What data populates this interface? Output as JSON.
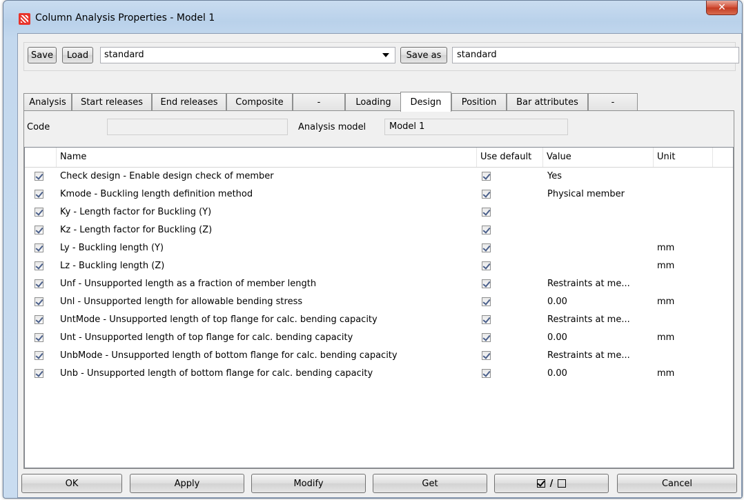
{
  "window": {
    "title": "Column Analysis Properties - Model 1"
  },
  "toolbar": {
    "save_label": "Save",
    "load_label": "Load",
    "preset_value": "standard",
    "save_as_label": "Save as",
    "save_as_value": "standard"
  },
  "tabs": [
    "Analysis",
    "Start releases",
    "End releases",
    "Composite",
    "-",
    "Loading",
    "Design",
    "Position",
    "Bar attributes",
    "-"
  ],
  "active_tab": "Design",
  "design": {
    "code_label": "Code",
    "code_value": "",
    "analysis_model_label": "Analysis model",
    "analysis_model_value": "Model 1"
  },
  "table": {
    "columns": [
      "Name",
      "Use default",
      "Value",
      "Unit"
    ],
    "rows": [
      {
        "checked": true,
        "name": "Check design - Enable design check of member",
        "use_default": true,
        "value": "Yes",
        "unit": ""
      },
      {
        "checked": true,
        "name": "Kmode - Buckling length definition method",
        "use_default": true,
        "value": "Physical member",
        "unit": ""
      },
      {
        "checked": true,
        "name": "Ky - Length factor for Buckling (Y)",
        "use_default": true,
        "value": "",
        "unit": ""
      },
      {
        "checked": true,
        "name": "Kz - Length factor for Buckling (Z)",
        "use_default": true,
        "value": "",
        "unit": ""
      },
      {
        "checked": true,
        "name": "Ly - Buckling length (Y)",
        "use_default": true,
        "value": "",
        "unit": "mm"
      },
      {
        "checked": true,
        "name": "Lz - Buckling length (Z)",
        "use_default": true,
        "value": "",
        "unit": "mm"
      },
      {
        "checked": true,
        "name": "Unf - Unsupported length as a fraction of member length",
        "use_default": true,
        "value": "Restraints at me...",
        "unit": ""
      },
      {
        "checked": true,
        "name": "Unl - Unsupported length for allowable bending stress",
        "use_default": true,
        "value": "0.00",
        "unit": "mm"
      },
      {
        "checked": true,
        "name": "UntMode - Unsupported length of top flange for calc. bending capacity",
        "use_default": true,
        "value": "Restraints at me...",
        "unit": ""
      },
      {
        "checked": true,
        "name": "Unt - Unsupported length of top flange for calc. bending capacity",
        "use_default": true,
        "value": "0.00",
        "unit": "mm"
      },
      {
        "checked": true,
        "name": "UnbMode - Unsupported length of bottom flange for calc. bending capacity",
        "use_default": true,
        "value": "Restraints at me...",
        "unit": ""
      },
      {
        "checked": true,
        "name": "Unb - Unsupported length of bottom flange for calc. bending capacity",
        "use_default": true,
        "value": "0.00",
        "unit": "mm"
      }
    ]
  },
  "buttons": {
    "ok": "OK",
    "apply": "Apply",
    "modify": "Modify",
    "get": "Get",
    "toggle_separator": "/",
    "cancel": "Cancel"
  },
  "colors": {
    "title_gradient": "#b9d1ea",
    "close_button": "#c33a22",
    "app_icon": "#e8342c"
  }
}
